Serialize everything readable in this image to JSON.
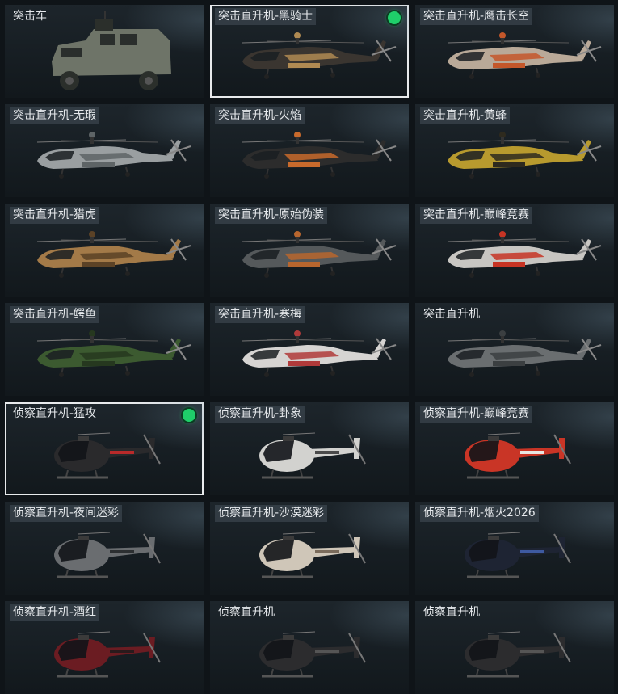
{
  "tiles": [
    {
      "label": "突击车",
      "kind": "vehicle",
      "body": "#6e7468",
      "accent": "#2b2f2b",
      "selected": false,
      "equipped": false,
      "label_bg": false
    },
    {
      "label": "突击直升机-黑骑士",
      "kind": "heli",
      "body": "#3a3530",
      "accent": "#b08a52",
      "selected": true,
      "equipped": true,
      "label_bg": true
    },
    {
      "label": "突击直升机-鹰击长空",
      "kind": "heli",
      "body": "#b9a998",
      "accent": "#c4572a",
      "selected": false,
      "equipped": false,
      "label_bg": true
    },
    {
      "label": "突击直升机-无瑕",
      "kind": "heli",
      "body": "#9a9fa1",
      "accent": "#5e6466",
      "selected": false,
      "equipped": false,
      "label_bg": true
    },
    {
      "label": "突击直升机-火焰",
      "kind": "heli",
      "body": "#2c2c2c",
      "accent": "#c86a2c",
      "selected": false,
      "equipped": false,
      "label_bg": true
    },
    {
      "label": "突击直升机-黄蜂",
      "kind": "heli",
      "body": "#b89a2e",
      "accent": "#2e2a1e",
      "selected": false,
      "equipped": false,
      "label_bg": true
    },
    {
      "label": "突击直升机-猎虎",
      "kind": "heli",
      "body": "#a37a48",
      "accent": "#5b4226",
      "selected": false,
      "equipped": false,
      "label_bg": true
    },
    {
      "label": "突击直升机-原始伪装",
      "kind": "heli",
      "body": "#55595b",
      "accent": "#b8662e",
      "selected": false,
      "equipped": false,
      "label_bg": true
    },
    {
      "label": "突击直升机-巅峰竞赛",
      "kind": "heli",
      "body": "#c8c6c2",
      "accent": "#c73424",
      "selected": false,
      "equipped": false,
      "label_bg": true
    },
    {
      "label": "突击直升机-鳄鱼",
      "kind": "heli",
      "body": "#3c5a30",
      "accent": "#26381f",
      "selected": false,
      "equipped": false,
      "label_bg": true
    },
    {
      "label": "突击直升机-寒梅",
      "kind": "heli",
      "body": "#d6d4d2",
      "accent": "#b03a3a",
      "selected": false,
      "equipped": false,
      "label_bg": true
    },
    {
      "label": "突击直升机",
      "kind": "heli",
      "body": "#6a6e70",
      "accent": "#3b3f41",
      "selected": false,
      "equipped": false,
      "label_bg": false
    },
    {
      "label": "侦察直升机-猛攻",
      "kind": "scout",
      "body": "#2a2a2c",
      "accent": "#b82a2a",
      "selected": true,
      "equipped": true,
      "label_bg": false
    },
    {
      "label": "侦察直升机-卦象",
      "kind": "scout",
      "body": "#d2d2cf",
      "accent": "#4a4a4a",
      "selected": false,
      "equipped": false,
      "label_bg": true
    },
    {
      "label": "侦察直升机-巅峰竞赛",
      "kind": "scout",
      "body": "#c93526",
      "accent": "#e8e6e2",
      "selected": false,
      "equipped": false,
      "label_bg": true
    },
    {
      "label": "侦察直升机-夜间迷彩",
      "kind": "scout",
      "body": "#6a6d70",
      "accent": "#2c2f31",
      "selected": false,
      "equipped": false,
      "label_bg": true
    },
    {
      "label": "侦察直升机-沙漠迷彩",
      "kind": "scout",
      "body": "#cfc6b8",
      "accent": "#7a6b5b",
      "selected": false,
      "equipped": false,
      "label_bg": true
    },
    {
      "label": "侦察直升机-烟火2026",
      "kind": "scout",
      "body": "#1e2433",
      "accent": "#3e5aa0",
      "selected": false,
      "equipped": false,
      "label_bg": true
    },
    {
      "label": "侦察直升机-酒红",
      "kind": "scout",
      "body": "#6b1c22",
      "accent": "#2a1a1c",
      "selected": false,
      "equipped": false,
      "label_bg": true
    },
    {
      "label": "侦察直升机",
      "kind": "scout",
      "body": "#2c2c2e",
      "accent": "#555",
      "selected": false,
      "equipped": false,
      "label_bg": false
    },
    {
      "label": "侦察直升机",
      "kind": "scout",
      "body": "#2c2c2e",
      "accent": "#555",
      "selected": false,
      "equipped": false,
      "label_bg": false
    }
  ]
}
